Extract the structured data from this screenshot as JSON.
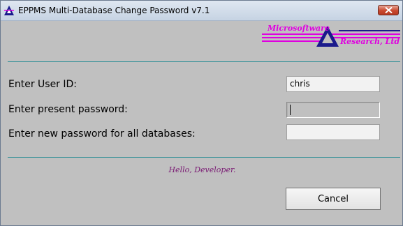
{
  "window": {
    "title": "EPPMS Multi-Database Change Password v7.1"
  },
  "logo": {
    "line1": "Microsoftware",
    "line2": "Research, Ltd",
    "text_color": "#e000e0",
    "mark_color": "#1a1a8c"
  },
  "form": {
    "user_id_label": "Enter User ID:",
    "user_id_value": "chris",
    "present_password_label": "Enter present password:",
    "present_password_value": "",
    "new_password_label": "Enter new password for all databases:",
    "new_password_value": ""
  },
  "greeting": "Hello, Developer.",
  "buttons": {
    "cancel_label": "Cancel"
  },
  "colors": {
    "background": "#c0c0c0",
    "rule": "#2f8e96",
    "greeting": "#7a1a73"
  }
}
